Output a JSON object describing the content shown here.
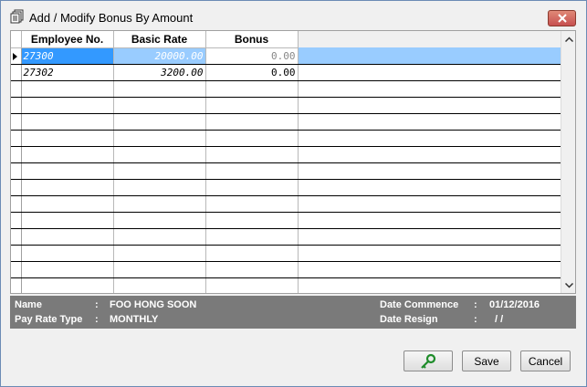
{
  "window": {
    "title": "Add / Modify Bonus By Amount"
  },
  "grid": {
    "columns": [
      "Employee No.",
      "Basic Rate",
      "Bonus"
    ],
    "rows": [
      {
        "employee_no": "27300",
        "basic_rate": "20000.00",
        "bonus": "0.00",
        "selected": true
      },
      {
        "employee_no": "27302",
        "basic_rate": "3200.00",
        "bonus": "0.00",
        "selected": false
      }
    ]
  },
  "info": {
    "name_label": "Name",
    "name_sep": ":",
    "name_value": "FOO HONG SOON",
    "payrate_label": "Pay Rate Type",
    "payrate_sep": ":",
    "payrate_value": "MONTHLY",
    "commence_label": "Date Commence",
    "commence_sep": ":",
    "commence_value": "01/12/2016",
    "resign_label": "Date Resign",
    "resign_sep": ":",
    "resign_value": "/ /"
  },
  "buttons": {
    "key_icon": "key-icon",
    "save_label": "Save",
    "cancel_label": "Cancel"
  },
  "colors": {
    "selection": "#3399ff",
    "selection_light": "#99ccff",
    "info_panel": "#7a7a7a",
    "close_button": "#c75050"
  }
}
